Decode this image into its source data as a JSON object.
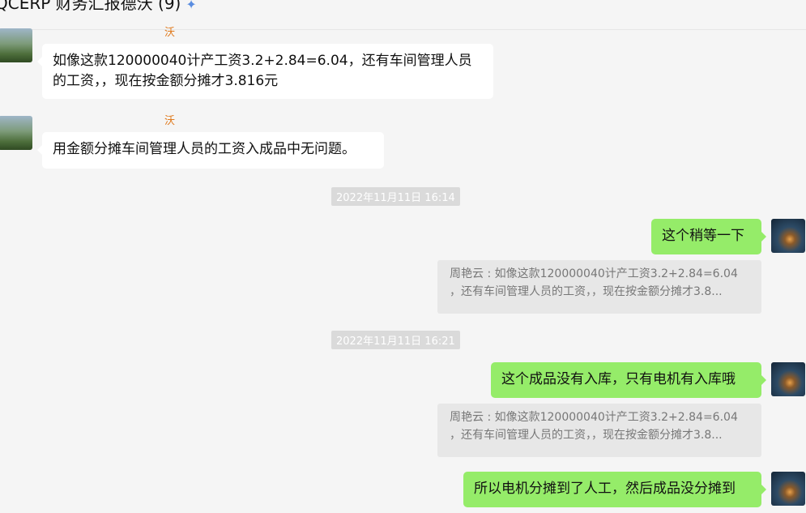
{
  "header": {
    "title": "QCERP 财务汇报德沃 (9)"
  },
  "messages": [
    {
      "sender": "沃",
      "text_lines": [
        "如像这款120000040计产工资3.2+2.84=6.04，还有车间管理人员",
        "的工资，，现在按金额分摊才3.816元"
      ]
    },
    {
      "sender": "沃",
      "text": "用金额分摊车间管理人员的工资入成品中无问题。"
    },
    {
      "timestamp": "2022年11月11日 16:14"
    },
    {
      "text": "这个稍等一下",
      "quote_lines": [
        "周艳云 : 如像这款120000040计产工资3.2+2.84=6.04",
        "，还有车间管理人员的工资，，现在按金额分摊才3.8..."
      ]
    },
    {
      "timestamp": "2022年11月11日 16:21"
    },
    {
      "text": "这个成品没有入库，只有电机有入库哦",
      "quote_lines": [
        "周艳云 : 如像这款120000040计产工资3.2+2.84=6.04",
        "，还有车间管理人员的工资，，现在按金额分摊才3.8..."
      ]
    },
    {
      "text": "所以电机分摊到了人工，然后成品没分摊到"
    }
  ],
  "colors": {
    "outgoing_bubble": "#95ec69",
    "incoming_bubble": "#ffffff",
    "sender_name": "#e07b1f",
    "background": "#f5f5f5"
  }
}
